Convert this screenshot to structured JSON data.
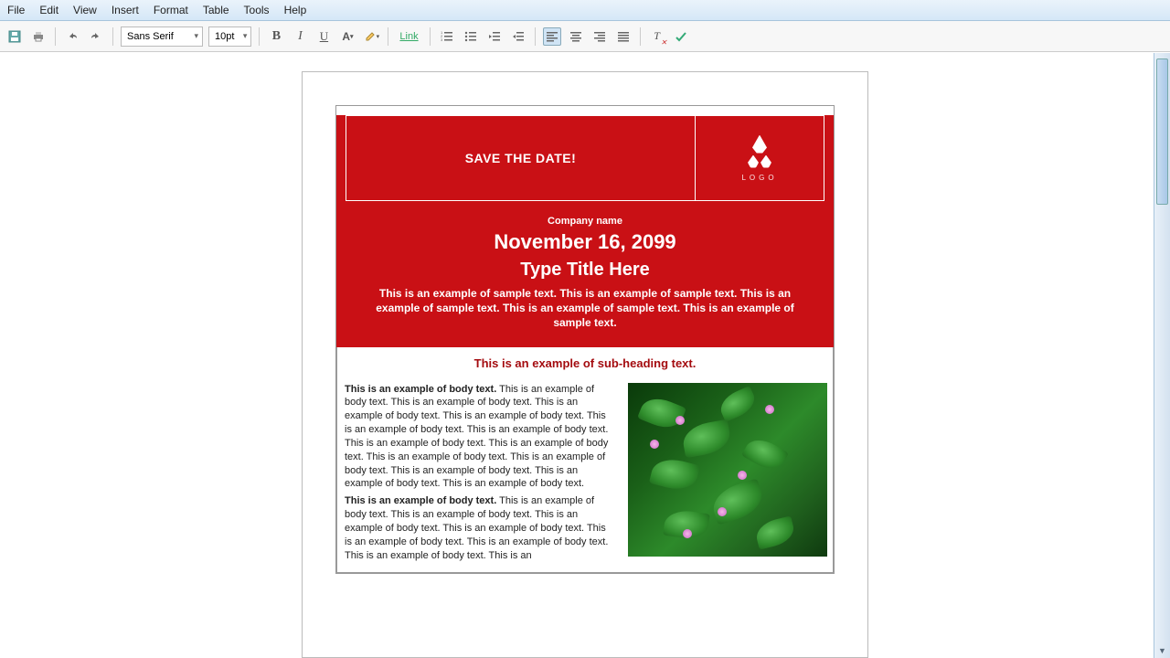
{
  "menu": {
    "file": "File",
    "edit": "Edit",
    "view": "View",
    "insert": "Insert",
    "format": "Format",
    "table": "Table",
    "tools": "Tools",
    "help": "Help"
  },
  "toolbar": {
    "font_family": "Sans Serif",
    "font_size": "10pt",
    "link_label": "Link"
  },
  "document": {
    "banner": "SAVE THE DATE!",
    "logo_label": "LOGO",
    "company": "Company name",
    "date": "November 16, 2099",
    "title": "Type Title Here",
    "sample": "This is an example of sample text. This is an example of sample text. This is an example of sample text. This is an example of sample text. This is an example of sample text.",
    "subheading": "This is an example of sub-heading text.",
    "body_lead": "This is an example of body text.",
    "body_para": "This is an example of body text. This is an example of body text. This is an example of body text. This is an example of body text. This is an example of body text. This is an example of body text. This is an example of body text. This is an example of body text. This is an example of body text. This is an example of body text. This is an example of body text. This is an example of body text. This is an example of body text.",
    "body_lead2": "This is an example of body text.",
    "body_para2": "This is an example of body text. This is an example of body text. This is an example of body text. This is an example of body text. This is an example of body text. This is an example of body text. This is an example of body text. This is an"
  }
}
